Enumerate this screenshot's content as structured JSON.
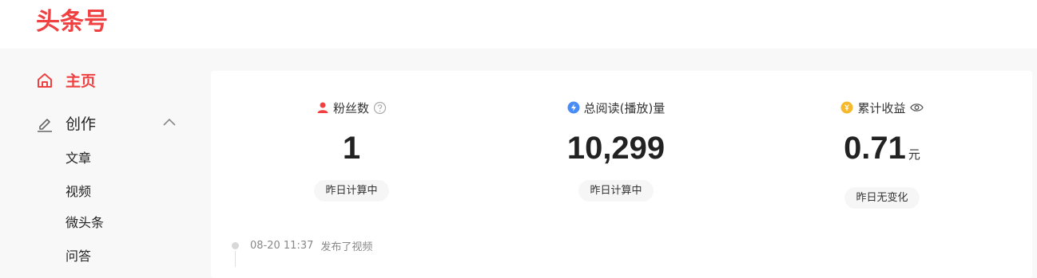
{
  "brand": {
    "logo_text": "头条号",
    "color": "#f04142"
  },
  "sidebar": {
    "home_label": "主页",
    "create_label": "创作",
    "create_items": [
      "文章",
      "视频",
      "微头条",
      "问答"
    ]
  },
  "stats": [
    {
      "title": "粉丝数",
      "value": "1",
      "unit": "",
      "status": "昨日计算中",
      "icon": "user-icon"
    },
    {
      "title": "总阅读(播放)量",
      "value": "10,299",
      "unit": "",
      "status": "昨日计算中",
      "icon": "lightning-icon"
    },
    {
      "title": "累计收益",
      "value": "0.71",
      "unit": "元",
      "status": "昨日无变化",
      "icon": "coin-icon"
    }
  ],
  "timeline": {
    "time": "08-20 11:37",
    "action": "发布了视频"
  }
}
